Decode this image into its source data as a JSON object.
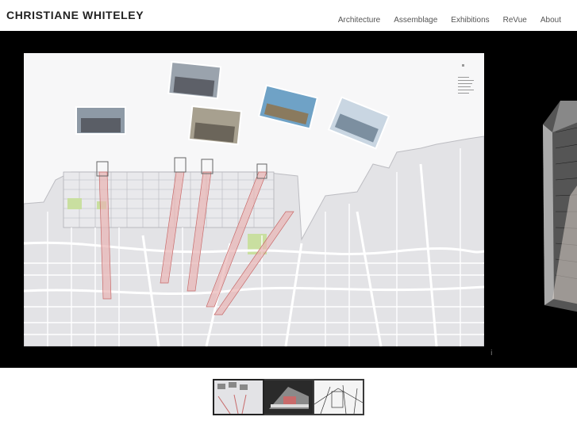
{
  "header": {
    "title": "CHRISTIANE WHITELEY",
    "nav": [
      {
        "label": "Architecture"
      },
      {
        "label": "Assemblage"
      },
      {
        "label": "Exhibitions"
      },
      {
        "label": "ReVue"
      },
      {
        "label": "About"
      }
    ]
  },
  "slideshow": {
    "active_index": 0,
    "info_glyph": "ⅰ",
    "thumbnails": [
      {
        "name": "map-plan-thumbnail"
      },
      {
        "name": "model-section-thumbnail"
      },
      {
        "name": "city-drawing-thumbnail"
      }
    ]
  },
  "colors": {
    "stage_background": "#000000",
    "accent_red": "#c86a6a",
    "map_grey": "#d9d9dc"
  }
}
